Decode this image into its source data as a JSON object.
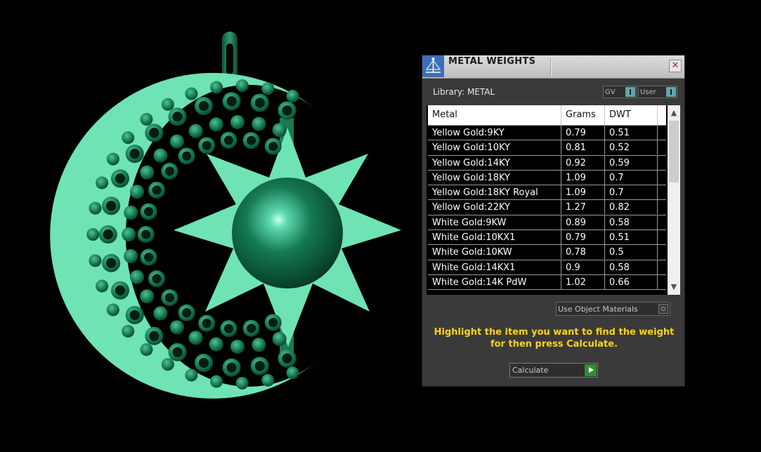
{
  "panel": {
    "title": "METAL WEIGHTS",
    "close_glyph": "✕",
    "title_icon": "balance-scale-icon",
    "library_label": "Library: METAL",
    "toggles": [
      {
        "label": "GV"
      },
      {
        "label": "User"
      }
    ],
    "table": {
      "headers": {
        "metal": "Metal",
        "grams": "Grams",
        "dwt": "DWT"
      },
      "rows": [
        {
          "metal": "Yellow Gold:9KY",
          "grams": "0.79",
          "dwt": "0.51"
        },
        {
          "metal": "Yellow Gold:10KY",
          "grams": "0.81",
          "dwt": "0.52"
        },
        {
          "metal": "Yellow Gold:14KY",
          "grams": "0.92",
          "dwt": "0.59"
        },
        {
          "metal": "Yellow Gold:18KY",
          "grams": "1.09",
          "dwt": "0.7"
        },
        {
          "metal": "Yellow Gold:18KY Royal",
          "grams": "1.09",
          "dwt": "0.7"
        },
        {
          "metal": "Yellow Gold:22KY",
          "grams": "1.27",
          "dwt": "0.82"
        },
        {
          "metal": "White Gold:9KW",
          "grams": "0.89",
          "dwt": "0.58"
        },
        {
          "metal": "White Gold:10KX1",
          "grams": "0.79",
          "dwt": "0.51"
        },
        {
          "metal": "White Gold:10KW",
          "grams": "0.78",
          "dwt": "0.5"
        },
        {
          "metal": "White Gold:14KX1",
          "grams": "0.9",
          "dwt": "0.58"
        },
        {
          "metal": "White Gold:14K PdW",
          "grams": "1.02",
          "dwt": "0.66"
        }
      ]
    },
    "use_object_materials": "Use Object Materials",
    "hint_line1": "Highlight the item you want to find the weight",
    "hint_line2": "for then press Calculate.",
    "calculate_label": "Calculate"
  },
  "colors": {
    "model": "#6fe3b4",
    "model_dark": "#0f5a3c",
    "hint": "#ffd21c",
    "toggle_on": "#5fa7a9",
    "calc_play": "#2f8f2f"
  }
}
